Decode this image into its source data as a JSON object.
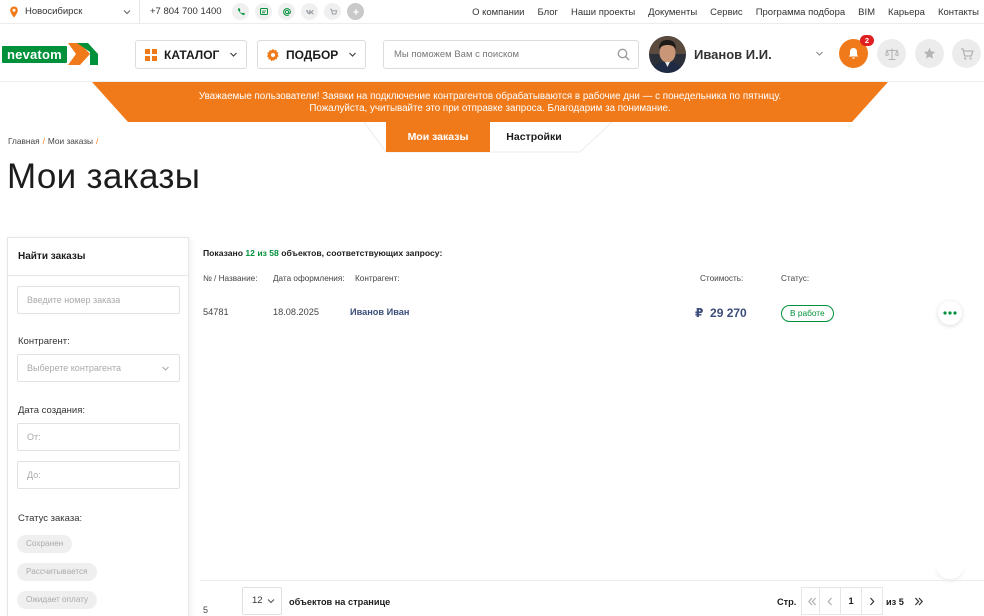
{
  "topbar": {
    "city": "Новосибирск",
    "phone": "+7 804 700 1400",
    "nav": [
      "О компании",
      "Блог",
      "Наши проекты",
      "Документы",
      "Сервис",
      "Программа подбора",
      "BIM",
      "Карьера",
      "Контакты"
    ]
  },
  "header": {
    "logo_text": "nevatom",
    "catalog_label": "КАТАЛОГ",
    "selection_label": "ПОДБОР",
    "search_placeholder": "Мы поможем Вам с поиском",
    "user_name": "Иванов И.И.",
    "notifications_count": "2"
  },
  "notice": {
    "line1": "Уважаемые пользователи! Заявки на подключение контрагентов обрабатываются в рабочие дни — с понедельника по пятницу.",
    "line2": "Пожалуйста, учитывайте это при отправке запроса. Благодарим за понимание."
  },
  "tabs": {
    "orders": "Мои заказы",
    "settings": "Настройки"
  },
  "breadcrumbs": {
    "home": "Главная",
    "current": "Мои заказы",
    "sep": "/"
  },
  "page_title": "Мои заказы",
  "filter": {
    "title": "Найти заказы",
    "order_number_placeholder": "Введите номер заказа",
    "contractor_label": "Контрагент:",
    "contractor_placeholder": "Выберете контрагента",
    "date_label": "Дата создания:",
    "date_from_placeholder": "От:",
    "date_to_placeholder": "До:",
    "status_label": "Статус заказа:",
    "status_chips": [
      "Сохранен",
      "Рассчитывается",
      "Ожидает оплату"
    ]
  },
  "results": {
    "shown_prefix": "Показано",
    "shown_count": "12 из 58",
    "shown_suffix": "объектов, соответствующих запросу:",
    "columns": {
      "number": "№ / Название:",
      "date": "Дата оформления:",
      "contractor": "Контрагент:",
      "cost": "Стоимость:",
      "status": "Статус:"
    },
    "rows": [
      {
        "number": "54781",
        "date": "18.08.2025",
        "contractor": "Иванов Иван",
        "currency": "₽",
        "cost": "29 270",
        "status": "В работе"
      }
    ]
  },
  "pagination": {
    "per_page": "12",
    "per_page_label": "объектов на странице",
    "cut_text": "5",
    "page_label": "Стр.",
    "current_page": "1",
    "of_label": "из 5"
  },
  "colors": {
    "brand_green": "#00913a",
    "accent_orange": "#f07a1a",
    "badge_red": "#e02020",
    "link_blue": "#3c4d7a"
  }
}
